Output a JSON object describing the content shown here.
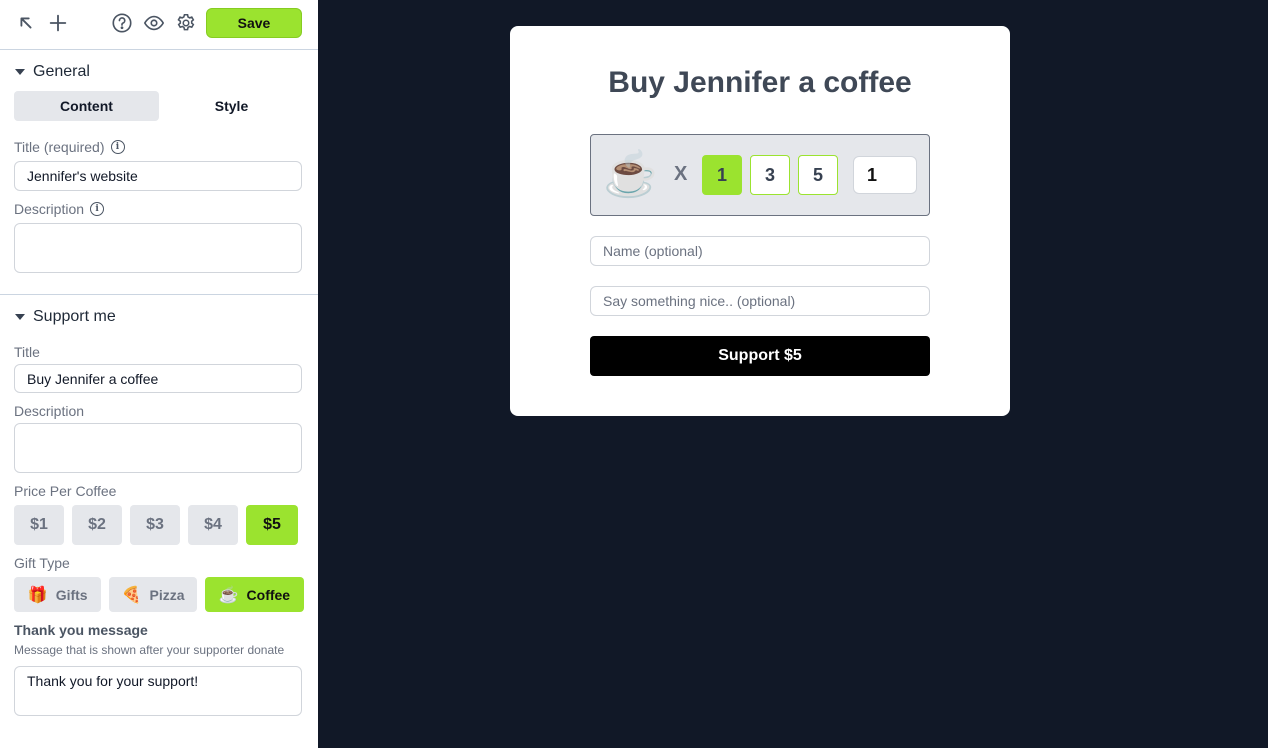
{
  "toolbar": {
    "icons": [
      "arrow-up-left-icon",
      "plus-icon",
      "help-icon",
      "eye-icon",
      "gear-icon"
    ],
    "save_label": "Save"
  },
  "sidebar": {
    "general": {
      "heading": "General",
      "tabs": [
        {
          "label": "Content",
          "active": true
        },
        {
          "label": "Style",
          "active": false
        }
      ],
      "title_label": "Title (required)",
      "title_value": "Jennifer's website",
      "description_label": "Description",
      "description_value": ""
    },
    "support": {
      "heading": "Support me",
      "title_label": "Title",
      "title_value": "Buy Jennifer a coffee",
      "description_label": "Description",
      "description_value": "",
      "price_label": "Price Per Coffee",
      "prices": [
        "$1",
        "$2",
        "$3",
        "$4",
        "$5"
      ],
      "selected_price": "$5",
      "gift_label": "Gift Type",
      "gifts": [
        {
          "emoji": "🎁",
          "label": "Gifts",
          "active": false
        },
        {
          "emoji": "🍕",
          "label": "Pizza",
          "active": false
        },
        {
          "emoji": "☕",
          "label": "Coffee",
          "active": true
        }
      ],
      "thanks_label": "Thank you message",
      "thanks_help": "Message that is shown after your supporter donate",
      "thanks_value": "Thank you for your support!"
    }
  },
  "preview": {
    "title": "Buy Jennifer a coffee",
    "cup_emoji": "☕",
    "times": "X",
    "quantities": [
      "1",
      "3",
      "5"
    ],
    "selected_quantity": "1",
    "custom_quantity": "1",
    "name_placeholder": "Name (optional)",
    "message_placeholder": "Say something nice.. (optional)",
    "support_label": "Support $5"
  },
  "colors": {
    "accent": "#9be32f",
    "canvas_bg": "#111827",
    "button_dark": "#000000"
  }
}
